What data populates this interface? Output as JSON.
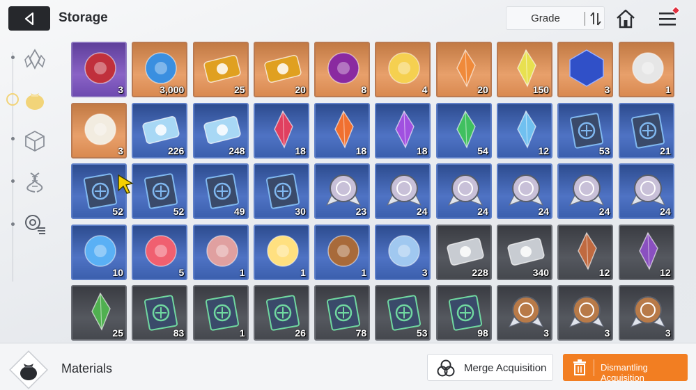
{
  "header": {
    "title": "Storage",
    "back_icon": "back-arrow-icon",
    "grade_label": "Grade",
    "sort_icon": "sort-toggle-icon",
    "home_icon": "home-icon",
    "menu_icon": "hamburger-menu-icon"
  },
  "sidebar": {
    "items": [
      {
        "icon": "crystal-icon",
        "active": false
      },
      {
        "icon": "pouch-icon",
        "active": true
      },
      {
        "icon": "cube-icon",
        "active": false
      },
      {
        "icon": "dna-icon",
        "active": false
      },
      {
        "icon": "gear-list-icon",
        "active": false
      }
    ],
    "active_color": "#f2d479"
  },
  "grid": {
    "rows": [
      [
        {
          "item": "dark-core",
          "qty": "3",
          "rarity": "purple",
          "color": "#c0303c"
        },
        {
          "item": "blue-eye-sigil",
          "qty": "3,000",
          "rarity": "orange",
          "color": "#3a8fe0"
        },
        {
          "item": "gold-ticket-portrait",
          "qty": "25",
          "rarity": "orange",
          "color": "#e0a020"
        },
        {
          "item": "gold-ticket-compass",
          "qty": "20",
          "rarity": "orange",
          "color": "#e0a020"
        },
        {
          "item": "purple-eye-orb",
          "qty": "8",
          "rarity": "orange",
          "color": "#8a2aa0"
        },
        {
          "item": "golden-feather",
          "qty": "4",
          "rarity": "orange",
          "color": "#f5d050"
        },
        {
          "item": "orange-crystal",
          "qty": "20",
          "rarity": "orange",
          "color": "#f08a3a"
        },
        {
          "item": "gold-shards",
          "qty": "150",
          "rarity": "orange",
          "color": "#e8e050"
        },
        {
          "item": "blue-cube-gem",
          "qty": "3",
          "rarity": "orange",
          "color": "#3050c8"
        },
        {
          "item": "card-stack",
          "qty": "1",
          "rarity": "orange",
          "color": "#e6e6e6"
        }
      ],
      [
        {
          "item": "sealed-letter",
          "qty": "3",
          "rarity": "orange",
          "color": "#f2ece0"
        },
        {
          "item": "blue-ticket-portrait",
          "qty": "226",
          "rarity": "blue",
          "color": "#a8d8f5"
        },
        {
          "item": "blue-ticket-compass",
          "qty": "248",
          "rarity": "blue",
          "color": "#a8d8f5"
        },
        {
          "item": "red-shard",
          "qty": "18",
          "rarity": "blue",
          "color": "#e04060"
        },
        {
          "item": "fire-shard",
          "qty": "18",
          "rarity": "blue",
          "color": "#f07030"
        },
        {
          "item": "violet-shard",
          "qty": "18",
          "rarity": "blue",
          "color": "#a050e0"
        },
        {
          "item": "green-shard",
          "qty": "54",
          "rarity": "blue",
          "color": "#40c060"
        },
        {
          "item": "ice-shard",
          "qty": "12",
          "rarity": "blue",
          "color": "#70c0f0"
        },
        {
          "item": "book-swords",
          "qty": "53",
          "rarity": "blue",
          "color": "#80b8f0"
        },
        {
          "item": "book-shield",
          "qty": "21",
          "rarity": "blue",
          "color": "#80b8f0"
        }
      ],
      [
        {
          "item": "book-target",
          "qty": "52",
          "rarity": "blue",
          "color": "#80b8f0"
        },
        {
          "item": "book-wings",
          "qty": "52",
          "rarity": "blue",
          "color": "#80b8f0"
        },
        {
          "item": "book-crosshair",
          "qty": "49",
          "rarity": "blue",
          "color": "#80b8f0"
        },
        {
          "item": "book-rune",
          "qty": "30",
          "rarity": "blue",
          "color": "#80b8f0"
        },
        {
          "item": "medal-plus",
          "qty": "23",
          "rarity": "blue",
          "color": "#c8c0d8"
        },
        {
          "item": "medal-shield",
          "qty": "24",
          "rarity": "blue",
          "color": "#c8c0d8"
        },
        {
          "item": "medal-dot",
          "qty": "24",
          "rarity": "blue",
          "color": "#c8c0d8"
        },
        {
          "item": "medal-x",
          "qty": "24",
          "rarity": "blue",
          "color": "#c8c0d8"
        },
        {
          "item": "medal-cross",
          "qty": "24",
          "rarity": "blue",
          "color": "#c8c0d8"
        },
        {
          "item": "medal-ring",
          "qty": "24",
          "rarity": "blue",
          "color": "#c8c0d8"
        }
      ],
      [
        {
          "item": "blue-flame-core",
          "qty": "10",
          "rarity": "blue",
          "color": "#5ab0f5"
        },
        {
          "item": "strawberry-cake",
          "qty": "5",
          "rarity": "blue",
          "color": "#f06070"
        },
        {
          "item": "flower-bouquet",
          "qty": "1",
          "rarity": "blue",
          "color": "#e0a0a0"
        },
        {
          "item": "sparkler",
          "qty": "1",
          "rarity": "blue",
          "color": "#ffe080"
        },
        {
          "item": "teddy-bear",
          "qty": "1",
          "rarity": "blue",
          "color": "#a86a3a"
        },
        {
          "item": "blue-tome",
          "qty": "3",
          "rarity": "blue",
          "color": "#a0c8f0"
        },
        {
          "item": "silver-ticket-portrait",
          "qty": "228",
          "rarity": "gray",
          "color": "#c8ccd2"
        },
        {
          "item": "silver-ticket-compass",
          "qty": "340",
          "rarity": "gray",
          "color": "#c8ccd2"
        },
        {
          "item": "copper-shard",
          "qty": "12",
          "rarity": "gray",
          "color": "#c06a40"
        },
        {
          "item": "amethyst-shard",
          "qty": "12",
          "rarity": "gray",
          "color": "#8a50c0"
        }
      ],
      [
        {
          "item": "emerald-shard",
          "qty": "25",
          "rarity": "gray",
          "color": "#50b050"
        },
        {
          "item": "bronze-book-swords",
          "qty": "83",
          "rarity": "gray",
          "color": "#70d8a0"
        },
        {
          "item": "bronze-book-shield",
          "qty": "1",
          "rarity": "gray",
          "color": "#70d8a0"
        },
        {
          "item": "bronze-book-target",
          "qty": "26",
          "rarity": "gray",
          "color": "#70d8a0"
        },
        {
          "item": "bronze-book-wings",
          "qty": "78",
          "rarity": "gray",
          "color": "#70d8a0"
        },
        {
          "item": "bronze-book-crosshair",
          "qty": "53",
          "rarity": "gray",
          "color": "#70d8a0"
        },
        {
          "item": "bronze-book-rune",
          "qty": "98",
          "rarity": "gray",
          "color": "#70d8a0"
        },
        {
          "item": "bronze-medal-shield",
          "qty": "3",
          "rarity": "gray",
          "color": "#b87a48"
        },
        {
          "item": "bronze-medal-dot",
          "qty": "3",
          "rarity": "gray",
          "color": "#b87a48"
        },
        {
          "item": "bronze-medal-x",
          "qty": "3",
          "rarity": "gray",
          "color": "#b87a48"
        }
      ]
    ]
  },
  "footer": {
    "category_icon": "material-pouch-icon",
    "category_label": "Materials",
    "merge_label": "Merge Acquisition",
    "merge_icon": "venn-circles-icon",
    "dismantle_label": "Dismantling Acquisition",
    "dismantle_icon": "trash-bin-icon",
    "dismantle_color": "#f27e22"
  }
}
